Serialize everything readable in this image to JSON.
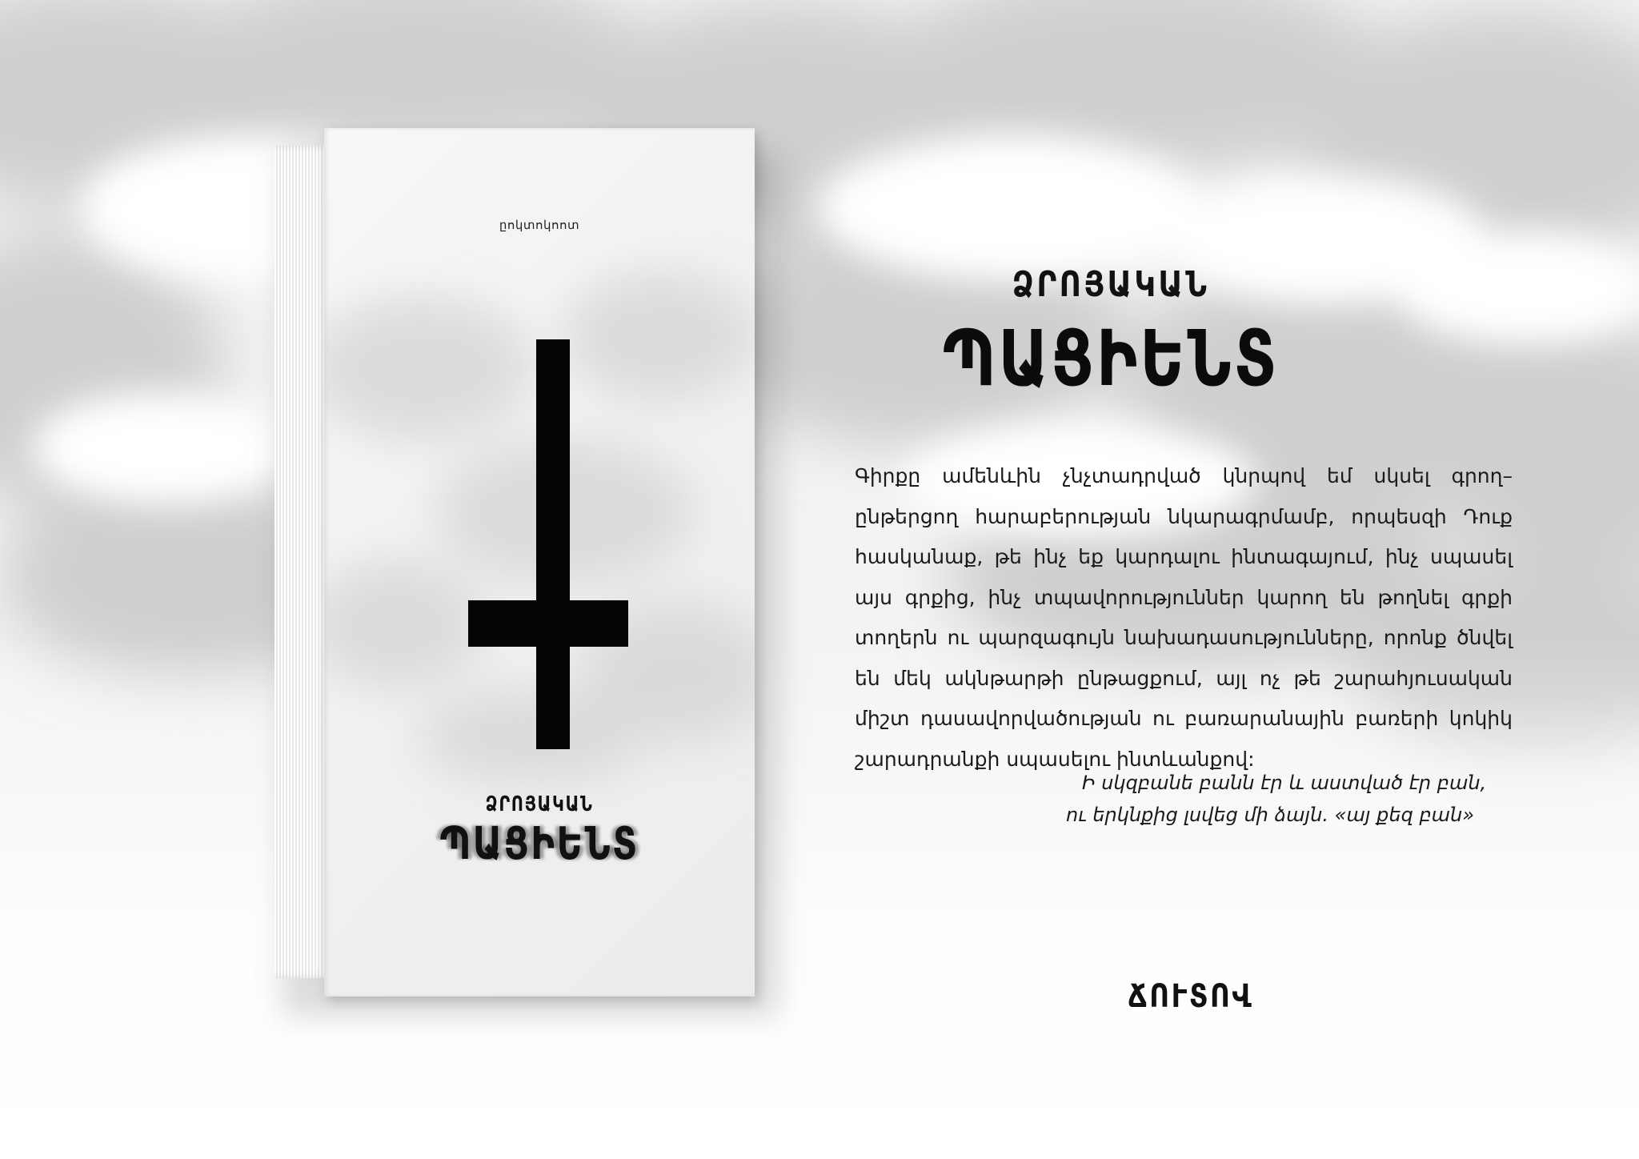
{
  "book": {
    "publisher": "ըոկտոկոոտ",
    "title_small": "ՁՐՈՅԱԿԱՆ",
    "title_large": "ՊԱՑԻԵՆՏ"
  },
  "heading": {
    "title_small": "ՁՐՈՅԱԿԱՆ",
    "title_large": "ՊԱՑԻԵՆՏ"
  },
  "description": "Գիրքը ամենևին չնչտադրված կնրպով եմ սկսել գրող–ընթերցող հարաբերության նկարագրմամբ, որպեսզի Դուք հասկանաք, թե ինչ եք կարդալու ինտագայում, ինչ սպասել այս գրքից, ինչ տպավորություններ կարող են թողնել գրքի տողերն ու պարզագույն նախադասությունները, որոնք ծնվել են մեկ ակնթարթի ընթացքում, այլ ոչ թե շարահյուսական միշտ դասավորվածության ու բառարանային բառերի կոկիկ շարադրանքի սպասելու ինտևանքով:",
  "quote": {
    "line1": "Ի սկզբանե բանն էր և աստված էր բան,",
    "line2": "ու երկնքից լսվեց մի ձայն. «այ քեզ բան»"
  },
  "brand": "ՃՈՒՏՈՎ",
  "colors": {
    "background": "#ffffff",
    "text": "#111111",
    "cross": "#050505",
    "cloud": "#d9d9d9"
  }
}
